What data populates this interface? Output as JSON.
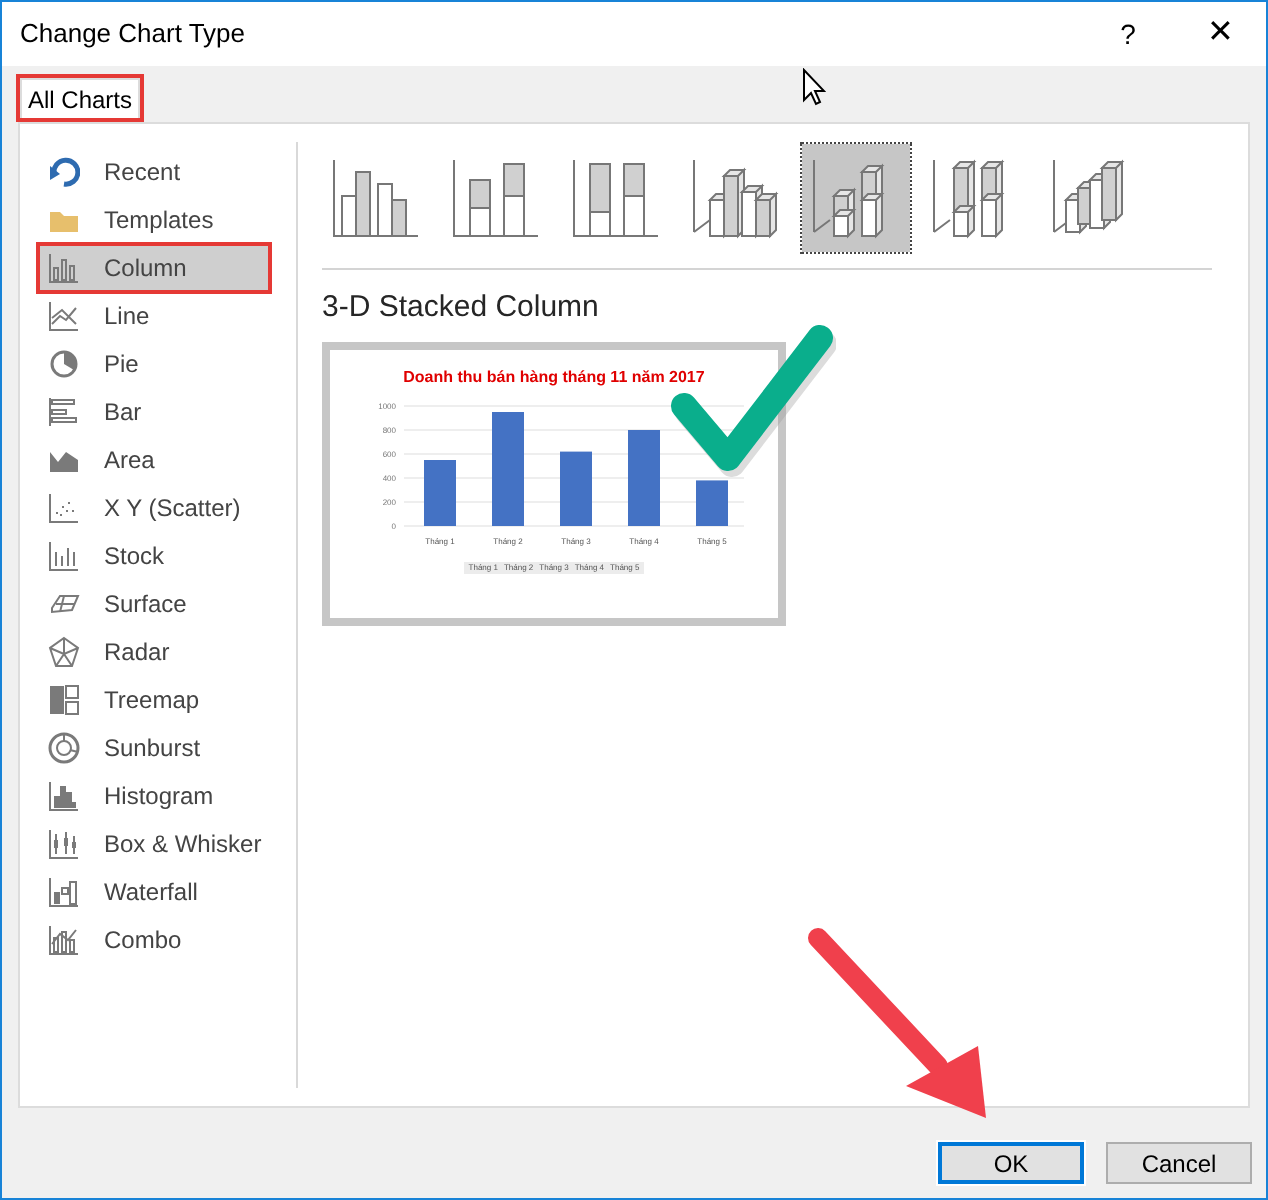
{
  "window": {
    "title": "Change Chart Type",
    "help": "?",
    "close": "✕"
  },
  "tabs": [
    {
      "label": "All Charts",
      "selected": true,
      "highlighted": true
    }
  ],
  "chart_types": [
    {
      "label": "Recent",
      "selected": false,
      "highlighted": false
    },
    {
      "label": "Templates",
      "selected": false,
      "highlighted": false
    },
    {
      "label": "Column",
      "selected": true,
      "highlighted": true
    },
    {
      "label": "Line",
      "selected": false,
      "highlighted": false
    },
    {
      "label": "Pie",
      "selected": false,
      "highlighted": false
    },
    {
      "label": "Bar",
      "selected": false,
      "highlighted": false
    },
    {
      "label": "Area",
      "selected": false,
      "highlighted": false
    },
    {
      "label": "X Y (Scatter)",
      "selected": false,
      "highlighted": false
    },
    {
      "label": "Stock",
      "selected": false,
      "highlighted": false
    },
    {
      "label": "Surface",
      "selected": false,
      "highlighted": false
    },
    {
      "label": "Radar",
      "selected": false,
      "highlighted": false
    },
    {
      "label": "Treemap",
      "selected": false,
      "highlighted": false
    },
    {
      "label": "Sunburst",
      "selected": false,
      "highlighted": false
    },
    {
      "label": "Histogram",
      "selected": false,
      "highlighted": false
    },
    {
      "label": "Box & Whisker",
      "selected": false,
      "highlighted": false
    },
    {
      "label": "Waterfall",
      "selected": false,
      "highlighted": false
    },
    {
      "label": "Combo",
      "selected": false,
      "highlighted": false
    }
  ],
  "subtypes": [
    {
      "selected": false
    },
    {
      "selected": false
    },
    {
      "selected": false
    },
    {
      "selected": false
    },
    {
      "selected": true
    },
    {
      "selected": false
    },
    {
      "selected": false
    }
  ],
  "subtype_title": "3-D Stacked Column",
  "preview": {
    "chart_data": {
      "type": "bar",
      "title": "Doanh thu bán hàng tháng 11 năm 2017",
      "categories": [
        "Tháng 1",
        "Tháng 2",
        "Tháng 3",
        "Tháng 4",
        "Tháng 5"
      ],
      "series": [
        {
          "color": "#4472c4",
          "values": [
            550,
            950,
            620,
            800,
            380
          ]
        }
      ],
      "ylim": [
        0,
        1000
      ],
      "grid": true,
      "yticks": [
        0,
        200,
        400,
        600,
        800,
        1000
      ]
    },
    "legend": [
      "Tháng 1",
      "Tháng 2",
      "Tháng 3",
      "Tháng 4",
      "Tháng 5"
    ]
  },
  "buttons": [
    {
      "label": "OK",
      "default": true,
      "highlighted": true
    },
    {
      "label": "Cancel",
      "default": false,
      "highlighted": false
    }
  ]
}
